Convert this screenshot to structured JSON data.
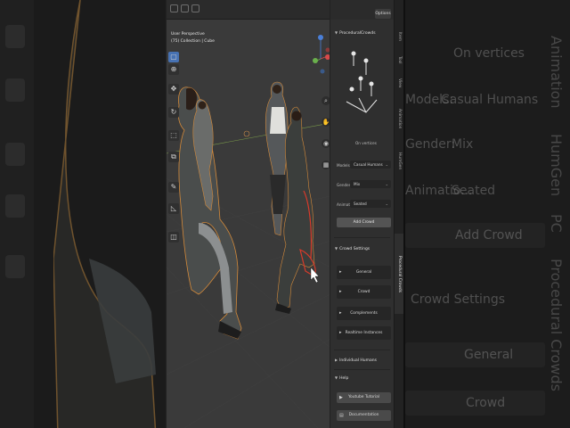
{
  "viewport": {
    "header_line1": "User Perspective",
    "header_line2": "(75) Collection | Cube"
  },
  "toolbar_icons": [
    "select-box-icon",
    "cursor-icon",
    "move-icon",
    "rotate-icon",
    "scale-icon",
    "transform-icon",
    "annotate-icon",
    "measure-icon",
    "add-cube-icon"
  ],
  "npanel": {
    "options_label": "Options",
    "procedural_crowds_header": "ProceduralCrowds",
    "preview_label": "On vertices",
    "models_label": "Models:",
    "models_value": "Casual Humans",
    "gender_label": "Gender:",
    "gender_value": "Mix",
    "animation_label": "Animatio...",
    "animation_value": "Seated",
    "add_crowd_label": "Add Crowd",
    "crowd_settings_header": "Crowd Settings",
    "general_label": "General",
    "crowd_label": "Crowd",
    "complements_label": "Complements",
    "realtime_instances_label": "Realtime Instances",
    "individual_humans_header": "Individual Humans",
    "help_header": "Help",
    "youtube_label": "Youtube Tutorial",
    "documentation_label": "Documentation"
  },
  "tabs": [
    "Item",
    "Tool",
    "View",
    "Animation",
    "HumGen",
    "Procedural Crowds"
  ],
  "background_ghost": {
    "on_vertices": "On vertices",
    "models": "Models:",
    "models_value": "Casual Humans",
    "gender": "Gender:",
    "gender_value": "Mix",
    "animation": "Animatio...",
    "animation_value": "Seated",
    "add_crowd": "Add Crowd",
    "crowd_settings": "Crowd Settings",
    "general": "General",
    "crowd": "Crowd",
    "vertical_text": "Procedural Crowds",
    "vertical_text2": "HumGen",
    "vertical_text3": "Animation",
    "vertical_text4": "PC"
  },
  "colors": {
    "accent_blue": "#4772b3",
    "axis_x": "#d84a4a",
    "axis_y": "#6ab04c",
    "axis_z": "#4a7fd8",
    "outline_selected": "#d48a3a"
  }
}
